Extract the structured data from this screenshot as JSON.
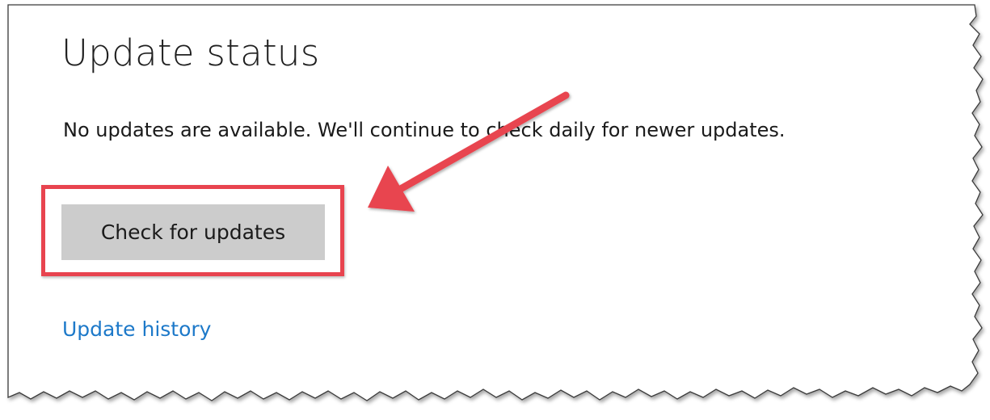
{
  "page": {
    "title": "Update status",
    "status_message": "No updates are available. We'll continue to check daily for newer updates.",
    "check_button_label": "Check for updates",
    "history_link_label": "Update history"
  },
  "annotation": {
    "color": "#e8444f"
  },
  "colors": {
    "button_bg": "#cccccc",
    "link": "#1d79c9",
    "text": "#1a1a1a"
  }
}
